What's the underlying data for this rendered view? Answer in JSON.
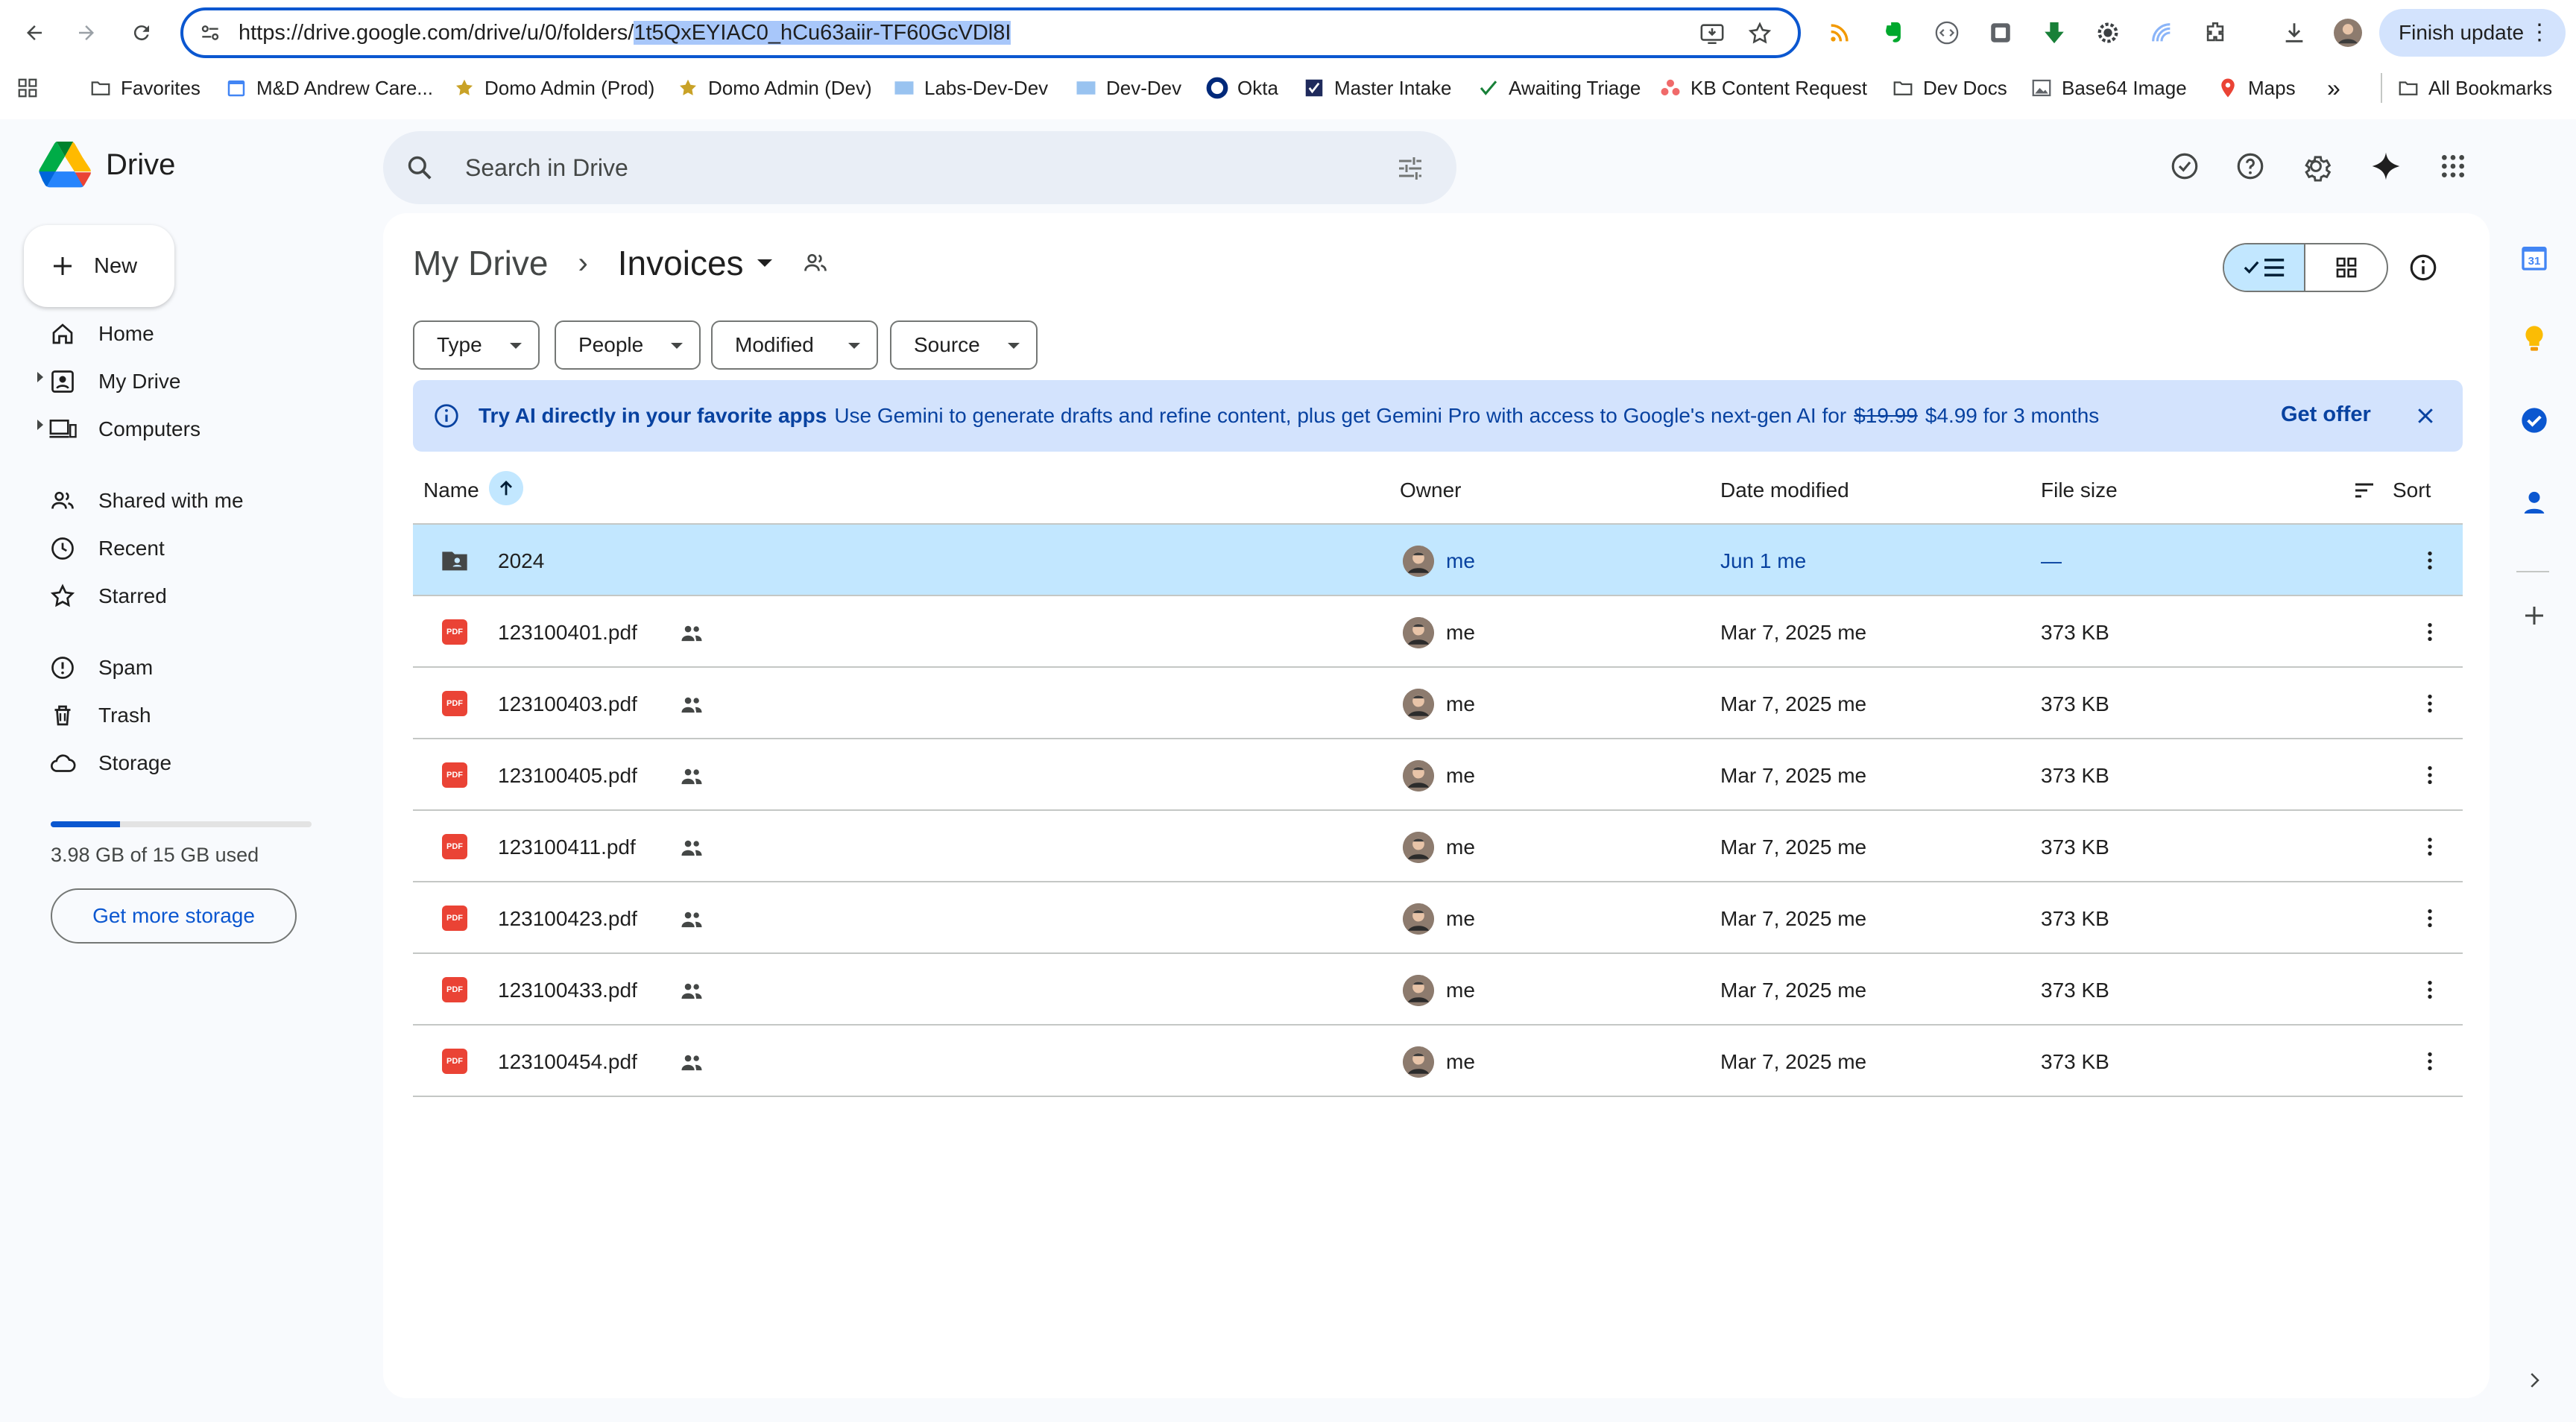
{
  "browser": {
    "url_prefix": "https://drive.google.com/drive/u/0/folders/",
    "url_selected": "1t5QxEYIAC0_hCu63aiir-TF60GcVDl8I",
    "finish_update": "Finish update",
    "bookmarks": [
      {
        "label": "Favorites",
        "icon": "folder-icon"
      },
      {
        "label": "M&D Andrew Care...",
        "icon": "calendar-icon"
      },
      {
        "label": "Domo Admin (Prod)",
        "icon": "star-icon"
      },
      {
        "label": "Domo Admin (Dev)",
        "icon": "star-icon"
      },
      {
        "label": "Labs-Dev-Dev",
        "icon": "domo-icon"
      },
      {
        "label": "Dev-Dev",
        "icon": "domo-icon"
      },
      {
        "label": "Okta",
        "icon": "okta-icon"
      },
      {
        "label": "Master Intake",
        "icon": "check-icon"
      },
      {
        "label": "Awaiting Triage",
        "icon": "checkmark-icon"
      },
      {
        "label": "KB Content Request",
        "icon": "asana-icon"
      },
      {
        "label": "Dev Docs",
        "icon": "folder-icon"
      },
      {
        "label": "Base64 Image",
        "icon": "image-icon"
      },
      {
        "label": "Maps",
        "icon": "maps-icon"
      }
    ],
    "more": "»",
    "all_bookmarks": "All Bookmarks"
  },
  "app": {
    "name": "Drive",
    "search_placeholder": "Search in Drive",
    "new_label": "New"
  },
  "sidebar": {
    "items": [
      {
        "label": "Home",
        "icon": "home-icon"
      },
      {
        "label": "My Drive",
        "icon": "my-drive-icon"
      },
      {
        "label": "Computers",
        "icon": "computers-icon"
      },
      {
        "label": "Shared with me",
        "icon": "shared-icon"
      },
      {
        "label": "Recent",
        "icon": "clock-icon"
      },
      {
        "label": "Starred",
        "icon": "star-icon"
      },
      {
        "label": "Spam",
        "icon": "spam-icon"
      },
      {
        "label": "Trash",
        "icon": "trash-icon"
      },
      {
        "label": "Storage",
        "icon": "cloud-icon"
      }
    ],
    "storage_used_fraction": 0.265,
    "storage_text": "3.98 GB of 15 GB used",
    "storage_button": "Get more storage"
  },
  "main": {
    "breadcrumb_root": "My Drive",
    "breadcrumb_sep": "›",
    "folder": "Invoices",
    "filters": [
      "Type",
      "People",
      "Modified",
      "Source"
    ],
    "banner": {
      "title": "Try AI directly in your favorite apps",
      "text_before": "Use Gemini to generate drafts and refine content, plus get Gemini Pro with access to Google's next-gen AI for",
      "old_price": "$19.99",
      "text_after": "$4.99 for 3 months",
      "offer": "Get offer"
    },
    "columns": {
      "name": "Name",
      "owner": "Owner",
      "date": "Date modified",
      "size": "File size",
      "sort": "Sort"
    },
    "rows": [
      {
        "name": "2024",
        "type": "folder",
        "shared": false,
        "owner": "me",
        "date": "Jun 1 me",
        "size": "—",
        "selected": true
      },
      {
        "name": "123100401.pdf",
        "type": "pdf",
        "shared": true,
        "owner": "me",
        "date": "Mar 7, 2025 me",
        "size": "373 KB"
      },
      {
        "name": "123100403.pdf",
        "type": "pdf",
        "shared": true,
        "owner": "me",
        "date": "Mar 7, 2025 me",
        "size": "373 KB"
      },
      {
        "name": "123100405.pdf",
        "type": "pdf",
        "shared": true,
        "owner": "me",
        "date": "Mar 7, 2025 me",
        "size": "373 KB"
      },
      {
        "name": "123100411.pdf",
        "type": "pdf",
        "shared": true,
        "owner": "me",
        "date": "Mar 7, 2025 me",
        "size": "373 KB"
      },
      {
        "name": "123100423.pdf",
        "type": "pdf",
        "shared": true,
        "owner": "me",
        "date": "Mar 7, 2025 me",
        "size": "373 KB"
      },
      {
        "name": "123100433.pdf",
        "type": "pdf",
        "shared": true,
        "owner": "me",
        "date": "Mar 7, 2025 me",
        "size": "373 KB"
      },
      {
        "name": "123100454.pdf",
        "type": "pdf",
        "shared": true,
        "owner": "me",
        "date": "Mar 7, 2025 me",
        "size": "373 KB"
      }
    ],
    "pdf_badge": "PDF"
  },
  "colors": {
    "accent": "#0b57d0",
    "selected_row": "#c2e7ff",
    "banner": "#d3e3fd",
    "pdf": "#ea4335"
  }
}
